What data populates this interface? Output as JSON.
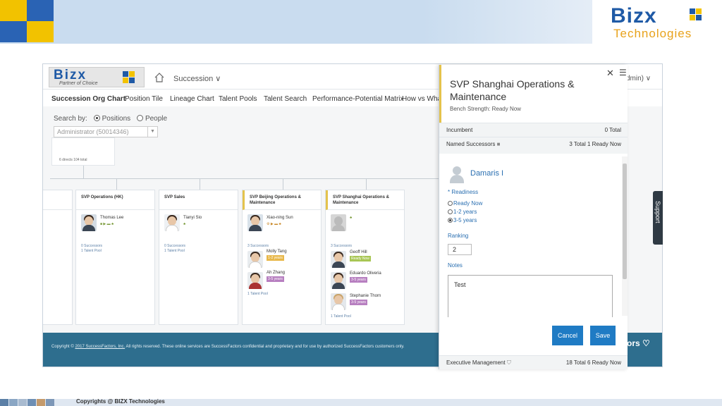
{
  "slide": {
    "brand_name": "Bizx",
    "brand_tagline": "Technologies",
    "copyright": "Copyrights @ BIZX Technologies"
  },
  "app": {
    "logo_name": "Bizx",
    "logo_tagline": "Partner of Choice",
    "module": "Succession ∨",
    "admin_label": "dmin) ∨",
    "tabs": [
      "Succession Org Chart",
      "Position Tile",
      "Lineage Chart",
      "Talent Pools",
      "Talent Search",
      "Performance-Potential Matrix",
      "How vs What"
    ],
    "search_by_label": "Search by:",
    "search_options": [
      "Positions",
      "People"
    ],
    "search_selected": "Positions",
    "search_value": "Administrator (50014346)",
    "top_card_text": "6 directs 104 total",
    "support_label": "Support",
    "footer_copyright_prefix": "Copyright ©",
    "footer_copyright_link": "2017 SuccessFactors, Inc.",
    "footer_copyright_suffix": "All rights reserved. These online services are SuccessFactors confidential and proprietary and for use by authorized SuccessFactors customers only.",
    "footer_brand": "tors ♡"
  },
  "org_cards": [
    {
      "title": "SVP Operations (HK)",
      "incumbent": "Thomas Lee",
      "successors": "0 Successors",
      "pools": "1 Talent Pool",
      "named": []
    },
    {
      "title": "SVP Sales",
      "incumbent": "Tianyi Sio",
      "successors": "0 Successors",
      "pools": "1 Talent Pool",
      "named": []
    },
    {
      "title": "SVP Beijing Operations & Maintenance",
      "incumbent": "Xiao-ning Sun",
      "successors": "3 Successors",
      "pools": "1 Talent Pool",
      "named": [
        {
          "name": "Molly Tang",
          "readiness": "1-2 years"
        },
        {
          "name": "Ah Zhang",
          "readiness": "3-5 years"
        }
      ]
    },
    {
      "title": "SVP Shanghai Operations & Maintenance",
      "incumbent": "",
      "successors": "3 Successors",
      "pools": "1 Talent Pool",
      "named": [
        {
          "name": "Geoff Hill",
          "readiness": "Ready Now"
        },
        {
          "name": "Eduardo Oliveria",
          "readiness": "3-5 years"
        },
        {
          "name": "Stephanie Thorn",
          "readiness": "3-5 years"
        }
      ]
    }
  ],
  "panel": {
    "title": "SVP Shanghai Operations & Maintenance",
    "bench_strength": "Bench Strength: Ready Now",
    "incumbent_label": "Incumbent",
    "incumbent_value": "0 Total",
    "named_label": "Named Successors",
    "named_value": "3 Total 1 Ready Now",
    "person_name": "Damaris I",
    "readiness_label": "* Readiness",
    "readiness_options": [
      "Ready Now",
      "1-2 years",
      "3-5 years"
    ],
    "readiness_selected": "3-5 years",
    "ranking_label": "Ranking",
    "ranking_value": "2",
    "notes_label": "Notes",
    "notes_value": "Test",
    "cancel_label": "Cancel",
    "save_label": "Save",
    "exec_label": "Executive Management",
    "exec_value": "18 Total 6 Ready Now"
  },
  "colors": {
    "accent": "#1f7bc4",
    "header": "#c9dcef",
    "footer": "#2e6e8e",
    "highlight": "#e4c34c"
  }
}
